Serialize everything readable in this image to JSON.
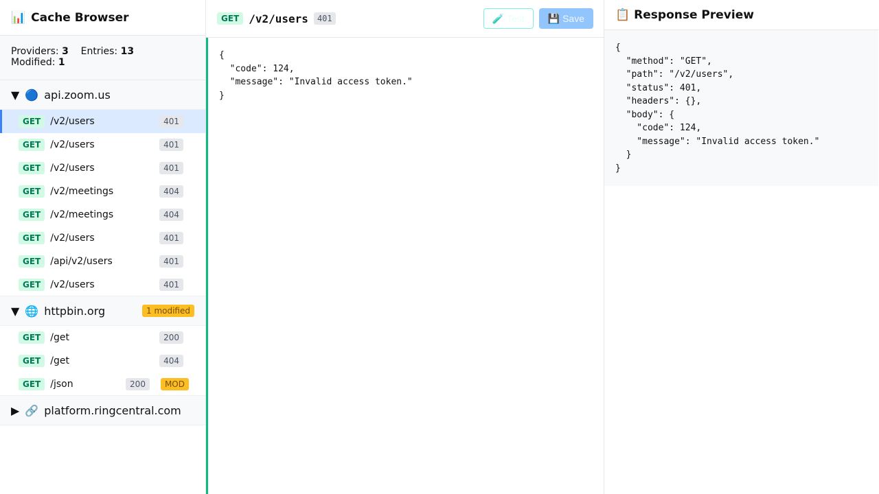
{
  "sidebar": {
    "title": "Cache Browser",
    "title_icon": "📊",
    "stats": {
      "providers_label": "Providers:",
      "providers": "3",
      "entries_label": "Entries:",
      "entries": "13",
      "modified_label": "Modified:",
      "modified": "1"
    },
    "providers": [
      {
        "toggle": "▼",
        "icon": "🔵",
        "name": "api.zoom.us",
        "badge": null,
        "entries": [
          {
            "method": "GET",
            "path": "/v2/users",
            "status": "401",
            "selected": true
          },
          {
            "method": "GET",
            "path": "/v2/users",
            "status": "401"
          },
          {
            "method": "GET",
            "path": "/v2/users",
            "status": "401"
          },
          {
            "method": "GET",
            "path": "/v2/meetings",
            "status": "404"
          },
          {
            "method": "GET",
            "path": "/v2/meetings",
            "status": "404"
          },
          {
            "method": "GET",
            "path": "/v2/users",
            "status": "401"
          },
          {
            "method": "GET",
            "path": "/api/v2/users",
            "status": "401"
          },
          {
            "method": "GET",
            "path": "/v2/users",
            "status": "401"
          }
        ]
      },
      {
        "toggle": "▼",
        "icon": "🌐",
        "name": "httpbin.org",
        "badge": "1 modified",
        "entries": [
          {
            "method": "GET",
            "path": "/get",
            "status": "200"
          },
          {
            "method": "GET",
            "path": "/get",
            "status": "404"
          },
          {
            "method": "GET",
            "path": "/json",
            "status": "200",
            "mod": "MOD"
          }
        ]
      },
      {
        "toggle": "▶",
        "icon": "🔗",
        "name": "platform.ringcentral.com",
        "badge": null,
        "entries": []
      }
    ]
  },
  "editor": {
    "method": "GET",
    "path": "/v2/users",
    "status": "401",
    "test_label": "Test",
    "test_icon": "🧪",
    "save_label": "Save",
    "save_icon": "💾",
    "content": "{\n  \"code\": 124,\n  \"message\": \"Invalid access token.\"\n}"
  },
  "preview": {
    "title": "Response Preview",
    "icon": "📋",
    "content": "{\n  \"method\": \"GET\",\n  \"path\": \"/v2/users\",\n  \"status\": 401,\n  \"headers\": {},\n  \"body\": {\n    \"code\": 124,\n    \"message\": \"Invalid access token.\"\n  }\n}"
  },
  "colors": {
    "accent": "#10b981",
    "selected": "#dbeafe",
    "modified": "#fbbf24",
    "get": "#047857"
  }
}
